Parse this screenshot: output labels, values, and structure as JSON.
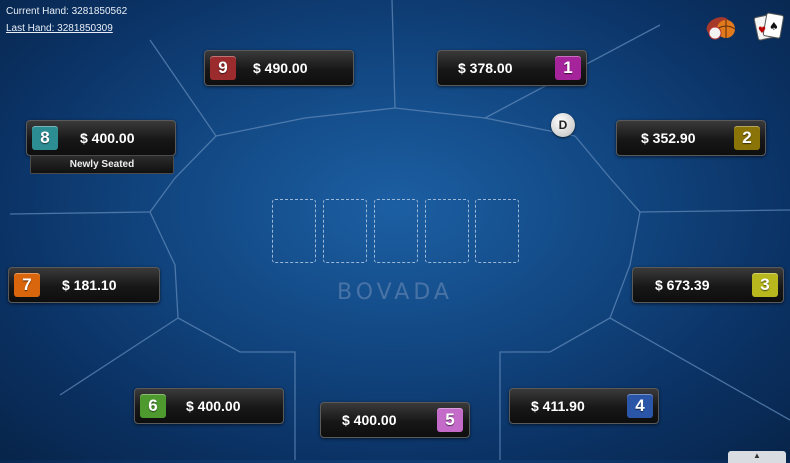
{
  "hand_info": {
    "current_label": "Current Hand: 3281850562",
    "last_label": "Last Hand: 3281850309"
  },
  "table": {
    "logo": "BOVADA",
    "dealer_button": "D",
    "board_slots": 5
  },
  "seats": [
    {
      "seat": "9",
      "stack": "$ 490.00",
      "color": "#9b2b2d"
    },
    {
      "seat": "1",
      "stack": "$ 378.00",
      "color": "#a5249b"
    },
    {
      "seat": "8",
      "stack": "$ 400.00",
      "color": "#2c8d93",
      "status": "Newly Seated"
    },
    {
      "seat": "2",
      "stack": "$ 352.90",
      "color": "#8a7408"
    },
    {
      "seat": "7",
      "stack": "$ 181.10",
      "color": "#d9650c"
    },
    {
      "seat": "3",
      "stack": "$ 673.39",
      "color": "#b8b81e"
    },
    {
      "seat": "6",
      "stack": "$ 400.00",
      "color": "#4e9a2f"
    },
    {
      "seat": "5",
      "stack": "$ 400.00",
      "color": "#c46ac9"
    },
    {
      "seat": "4",
      "stack": "$ 411.90",
      "color": "#2b56a8"
    }
  ],
  "toolbar": {
    "sports_icon": "sports-balls-icon",
    "cards_icon": "playing-cards-icon"
  },
  "scroll_tab_glyph": "▲"
}
